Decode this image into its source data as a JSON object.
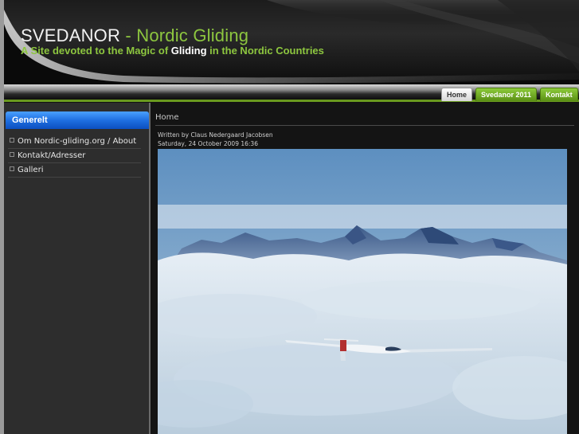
{
  "header": {
    "title_name": "SVEDANOR",
    "title_dash": " - ",
    "title_sub": "Nordic Gliding",
    "tagline_pre": "A Site devoted to the Magic of ",
    "tagline_highlight": "Gliding",
    "tagline_post": " in the Nordic Countries"
  },
  "nav": {
    "tabs": [
      {
        "label": "Home",
        "active": true
      },
      {
        "label": "Svedanor 2011",
        "active": false
      },
      {
        "label": "Kontakt",
        "active": false
      }
    ]
  },
  "sidebar": {
    "heading": "Generelt",
    "items": [
      {
        "label": "Om Nordic-gliding.org / About"
      },
      {
        "label": "Kontakt/Adresser"
      },
      {
        "label": "Galleri"
      }
    ]
  },
  "article": {
    "section_title": "Home",
    "author": "Written by Claus Nedergaard Jacobsen",
    "date": "Saturday, 24 October 2009 16:36"
  },
  "colors": {
    "accent_green": "#8dc63f",
    "sidebar_header_blue": "#1f6fe0",
    "background": "#111111"
  }
}
